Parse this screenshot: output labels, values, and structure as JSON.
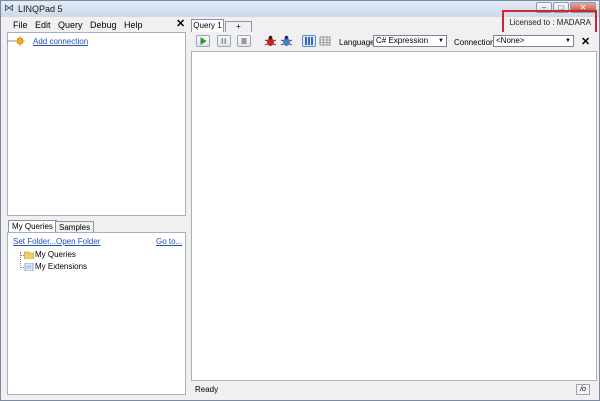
{
  "window": {
    "title": "LINQPad 5",
    "license": "Licensed to : MADARA"
  },
  "menu": {
    "file": "File",
    "edit": "Edit",
    "query": "Query",
    "debug": "Debug",
    "help": "Help"
  },
  "connections": {
    "add_label": "Add connection"
  },
  "left_tabs": {
    "my_queries": "My Queries",
    "samples": "Samples"
  },
  "queries_panel": {
    "set_folder": "Set Folder...",
    "open_folder": "Open Folder",
    "go_to": "Go to...",
    "tree": [
      "My Queries",
      "My Extensions"
    ]
  },
  "query_tabs": {
    "active": "Query 1",
    "add": "+"
  },
  "toolbar": {
    "language_label": "Language",
    "language_value": "C# Expression",
    "connection_label": "Connection",
    "connection_value": "<None>"
  },
  "status": {
    "text": "Ready",
    "button": "/o"
  },
  "colors": {
    "highlight_box": "#d0242e",
    "link": "#2050b8"
  }
}
